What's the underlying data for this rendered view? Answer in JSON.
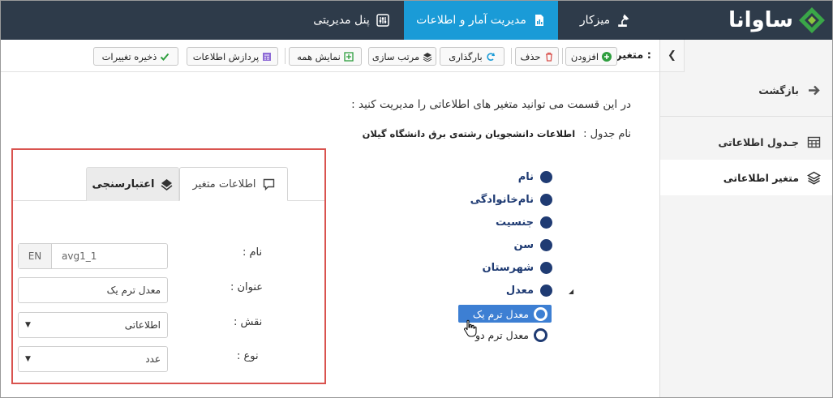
{
  "header": {
    "logo_text": "ساوانا",
    "tabs": [
      {
        "label": "پنل مدیریتی",
        "icon": "sliders-icon",
        "active": false
      },
      {
        "label": "مدیریت آمار و اطلاعات",
        "icon": "report-icon",
        "active": true
      },
      {
        "label": "میزکار",
        "icon": "desk-lamp-icon",
        "active": false
      }
    ],
    "colors": {
      "bar": "#2e3b4a",
      "active_tab": "#1a9bd7"
    }
  },
  "toolbar": {
    "label": "متغیر :",
    "add": "افزودن",
    "delete": "حذف",
    "reload": "بارگذاری",
    "sort": "مرتب سازی",
    "show_all": "نمایش همه",
    "process": "پردازش اطلاعات",
    "save": "ذخیره تغییرات"
  },
  "sidebar": {
    "items": [
      {
        "label": "بازگشت",
        "icon": "arrow-right-icon",
        "active": false
      },
      {
        "label": "جـدول اطلاعاتی",
        "icon": "table-icon",
        "active": false
      },
      {
        "label": "متغیر اطلاعاتی",
        "icon": "layers-icon",
        "active": true
      }
    ]
  },
  "main": {
    "intro": "در این قسمت می توانید متغیر های اطلاعاتی را مدیریت کنید :",
    "table_name_label": "نام جدول :",
    "table_name_value": "اطلاعات دانشجویان رشته‌ی برق دانشگاه گیلان"
  },
  "variables": [
    {
      "label": "نام"
    },
    {
      "label": "نام‌خانوادگی"
    },
    {
      "label": "جنسیت"
    },
    {
      "label": "سن"
    },
    {
      "label": "شهرستان"
    },
    {
      "label": "معدل",
      "children": [
        {
          "label": "معدل ترم یک",
          "selected": true
        },
        {
          "label": "معدل ترم دو",
          "selected": false
        }
      ]
    }
  ],
  "form": {
    "tabs": [
      {
        "label": "اطلاعات متغیر",
        "icon": "comment-icon",
        "active": true
      },
      {
        "label": "اعتبارسنجی",
        "icon": "validate-icon",
        "active": false
      }
    ],
    "name_label": "نام :",
    "name_addon": "EN",
    "name_value": "avg1_1",
    "title_label": "عنوان :",
    "title_value": "معدل ترم یک",
    "role_label": "نقش :",
    "role_value": "اطلاعاتی",
    "type_label": "نوع :",
    "type_value": "عدد",
    "outline_color": "#d9534f"
  }
}
